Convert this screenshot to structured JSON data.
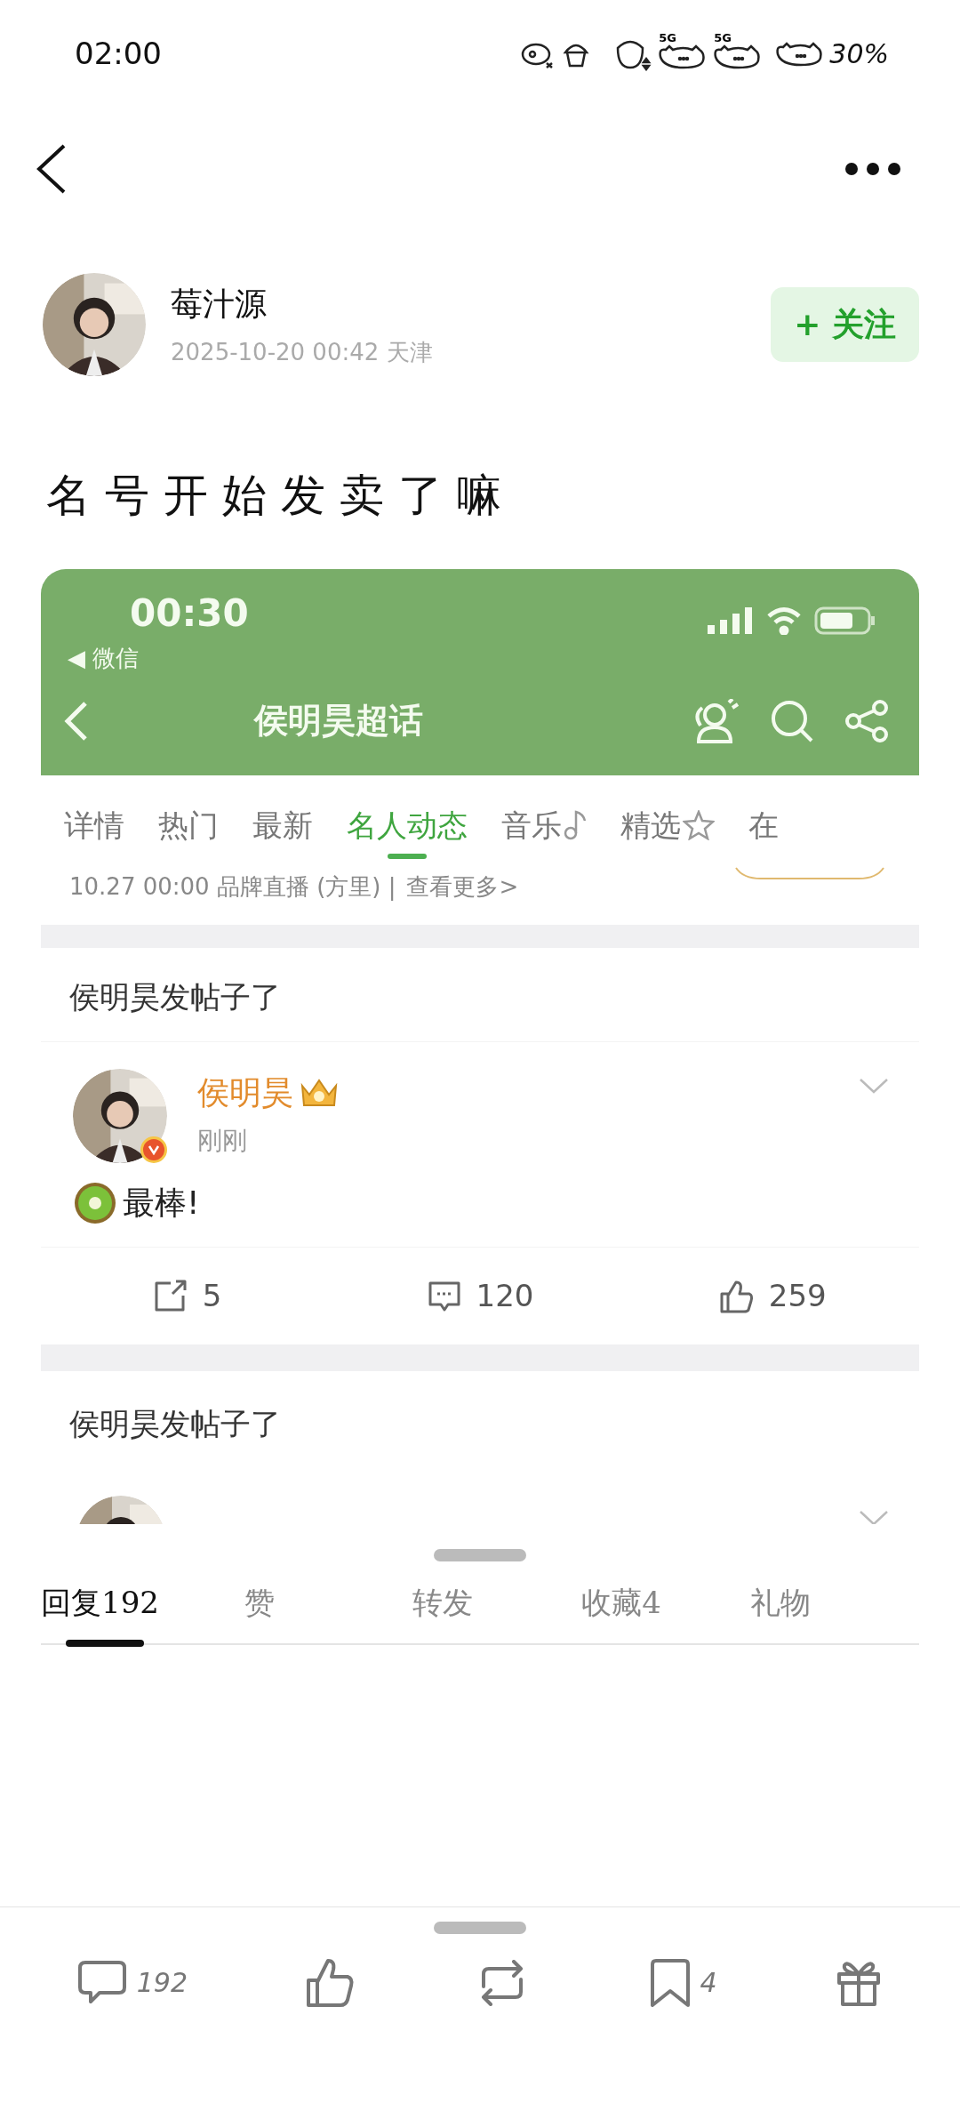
{
  "status_bar": {
    "time": "02:00",
    "network_labels": [
      "5G",
      "5G"
    ],
    "battery": "30%"
  },
  "author": {
    "name": "莓汁源",
    "meta": "2025-10-20 00:42 天津",
    "follow": "+ 关注",
    "following": false
  },
  "post_text": "名号开始发卖了嘛",
  "shared_screenshot": {
    "time": "00:30",
    "back_app": "◀ 微信",
    "title": "侯明昊超话",
    "tabs": [
      {
        "label": "详情",
        "selected": false,
        "kind": "plain"
      },
      {
        "label": "热门",
        "selected": false,
        "kind": "plain"
      },
      {
        "label": "最新",
        "selected": false,
        "kind": "plain"
      },
      {
        "label": "名人动态",
        "selected": true,
        "kind": "plain"
      },
      {
        "label": "音乐",
        "selected": false,
        "kind": "note"
      },
      {
        "label": "精选",
        "selected": false,
        "kind": "star"
      },
      {
        "label": "在",
        "selected": false,
        "kind": "plain"
      }
    ],
    "notice": "10.27 00:00 品牌直播 (方里) |",
    "notice_link": "查看更多>",
    "feed": [
      {
        "heading": "侯明昊发帖子了",
        "name": "侯明昊",
        "time": "刚刚",
        "text": "最棒!",
        "reposts": "5",
        "comments": "120",
        "likes": "259"
      },
      {
        "heading": "侯明昊发帖子了"
      }
    ]
  },
  "reply_tabs": [
    {
      "label": "回复192",
      "selected": true
    },
    {
      "label": "赞",
      "selected": false
    },
    {
      "label": "转发",
      "selected": false
    },
    {
      "label": "收藏4",
      "selected": false
    },
    {
      "label": "礼物",
      "selected": false
    }
  ],
  "bottom_bar": [
    {
      "kind": "comment",
      "count": "192"
    },
    {
      "kind": "like"
    },
    {
      "kind": "repost"
    },
    {
      "kind": "bookmark",
      "count": "4"
    },
    {
      "kind": "gift"
    }
  ]
}
